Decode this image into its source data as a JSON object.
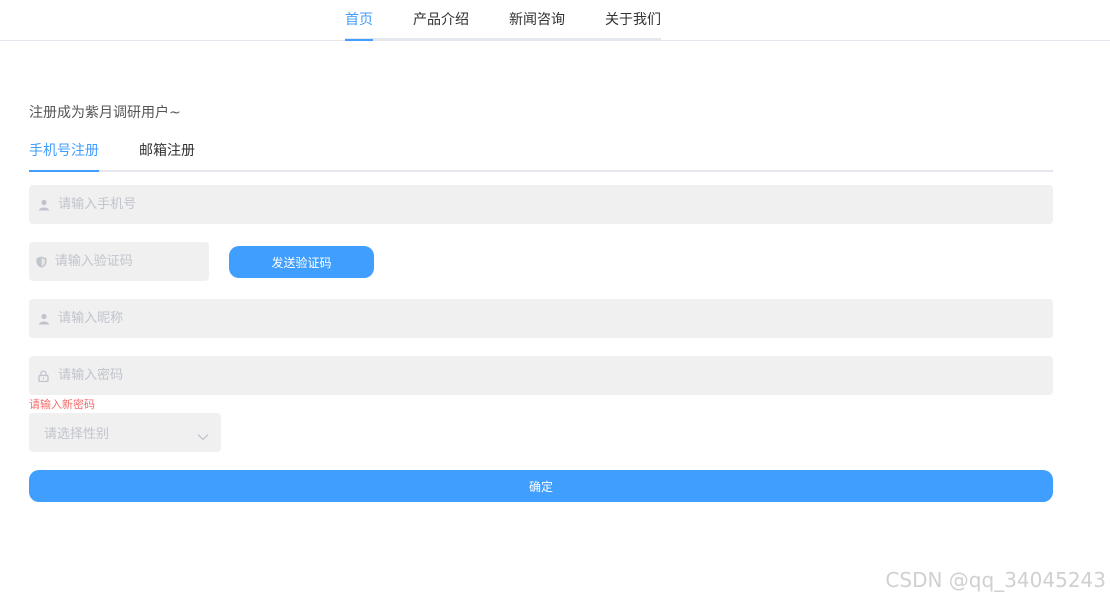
{
  "nav": {
    "items": [
      {
        "label": "首页",
        "active": true
      },
      {
        "label": "产品介绍",
        "active": false
      },
      {
        "label": "新闻咨询",
        "active": false
      },
      {
        "label": "关于我们",
        "active": false
      }
    ]
  },
  "form": {
    "heading": "注册成为紫月调研用户~",
    "tabs": [
      {
        "label": "手机号注册",
        "active": true
      },
      {
        "label": "邮箱注册",
        "active": false
      }
    ],
    "phone": {
      "placeholder": "请输入手机号",
      "icon": "user-icon"
    },
    "code": {
      "placeholder": "请输入验证码",
      "icon": "shield-icon"
    },
    "send_code_label": "发送验证码",
    "nickname": {
      "placeholder": "请输入昵称",
      "icon": "user-icon"
    },
    "password": {
      "placeholder": "请输入密码",
      "icon": "lock-icon"
    },
    "password_error": "请输入新密码",
    "gender": {
      "placeholder": "请选择性别"
    },
    "submit_label": "确定"
  },
  "colors": {
    "accent": "#409eff",
    "error": "#f56c6c",
    "field_bg": "#f0f0f0"
  },
  "watermark": "CSDN @qq_34045243"
}
